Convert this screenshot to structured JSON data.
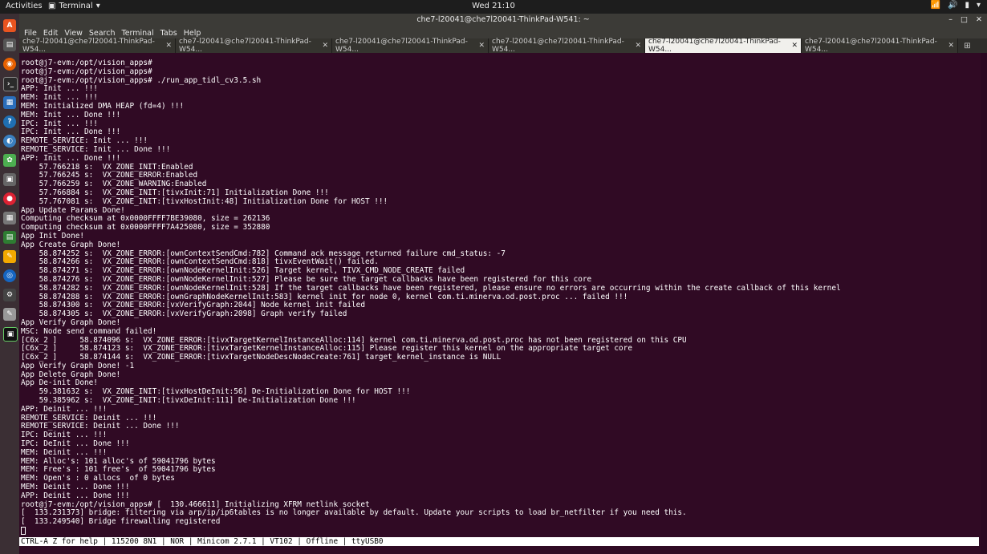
{
  "topbar": {
    "activities": "Activities",
    "app_name": "Terminal",
    "clock": "Wed 21:10"
  },
  "window": {
    "title": "che7-l20041@che7l20041-ThinkPad-W541: ~"
  },
  "menu": {
    "file": "File",
    "edit": "Edit",
    "view": "View",
    "search": "Search",
    "terminal": "Terminal",
    "tabs": "Tabs",
    "help": "Help"
  },
  "tabs": [
    {
      "label": "che7-l20041@che7l20041-ThinkPad-W54..."
    },
    {
      "label": "che7-l20041@che7l20041-ThinkPad-W54..."
    },
    {
      "label": "che7-l20041@che7l20041-ThinkPad-W54..."
    },
    {
      "label": "che7-l20041@che7l20041-ThinkPad-W54..."
    },
    {
      "label": "che7-l20041@che7l20041-ThinkPad-W54..."
    },
    {
      "label": "che7-l20041@che7l20041-ThinkPad-W54..."
    }
  ],
  "active_tab": 4,
  "terminal": {
    "lines": [
      "root@j7-evm:/opt/vision_apps#",
      "root@j7-evm:/opt/vision_apps#",
      "root@j7-evm:/opt/vision_apps# ./run_app_tidl_cv3.5.sh",
      "APP: Init ... !!!",
      "MEM: Init ... !!!",
      "MEM: Initialized DMA HEAP (fd=4) !!!",
      "MEM: Init ... Done !!!",
      "IPC: Init ... !!!",
      "IPC: Init ... Done !!!",
      "REMOTE_SERVICE: Init ... !!!",
      "REMOTE_SERVICE: Init ... Done !!!",
      "APP: Init ... Done !!!",
      "    57.766218 s:  VX_ZONE_INIT:Enabled",
      "    57.766245 s:  VX_ZONE_ERROR:Enabled",
      "    57.766259 s:  VX_ZONE_WARNING:Enabled",
      "    57.766884 s:  VX_ZONE_INIT:[tivxInit:71] Initialization Done !!!",
      "    57.767081 s:  VX_ZONE_INIT:[tivxHostInit:48] Initialization Done for HOST !!!",
      "App Update Params Done!",
      "Computing checksum at 0x0000FFFF7BE39080, size = 262136",
      "Computing checksum at 0x0000FFFF7A425080, size = 352880",
      "App Init Done!",
      "App Create Graph Done!",
      "    58.874252 s:  VX_ZONE_ERROR:[ownContextSendCmd:782] Command ack message returned failure cmd_status: -7",
      "    58.874266 s:  VX_ZONE_ERROR:[ownContextSendCmd:818] tivxEventWait() failed.",
      "    58.874271 s:  VX_ZONE_ERROR:[ownNodeKernelInit:526] Target kernel, TIVX_CMD_NODE_CREATE failed",
      "    58.874276 s:  VX_ZONE_ERROR:[ownNodeKernelInit:527] Please be sure the target callbacks have been registered for this core",
      "    58.874282 s:  VX_ZONE_ERROR:[ownNodeKernelInit:528] If the target callbacks have been registered, please ensure no errors are occurring within the create callback of this kernel",
      "    58.874288 s:  VX_ZONE_ERROR:[ownGraphNodeKernelInit:583] kernel init for node 0, kernel com.ti.minerva.od.post.proc ... failed !!!",
      "    58.874300 s:  VX_ZONE_ERROR:[vxVerifyGraph:2044] Node kernel init failed",
      "    58.874305 s:  VX_ZONE_ERROR:[vxVerifyGraph:2098] Graph verify failed",
      "App Verify Graph Done!",
      "MSC: Node send command failed!",
      "[C6x_2 ]     58.874096 s:  VX_ZONE_ERROR:[tivxTargetKernelInstanceAlloc:114] kernel com.ti.minerva.od.post.proc has not been registered on this CPU",
      "[C6x_2 ]     58.874123 s:  VX_ZONE_ERROR:[tivxTargetKernelInstanceAlloc:115] Please register this kernel on the appropriate target core",
      "[C6x_2 ]     58.874144 s:  VX_ZONE_ERROR:[tivxTargetNodeDescNodeCreate:761] target_kernel_instance is NULL",
      "App Verify Graph Done! -1",
      "App Delete Graph Done!",
      "App De-init Done!",
      "    59.381632 s:  VX_ZONE_INIT:[tivxHostDeInit:56] De-Initialization Done for HOST !!!",
      "    59.385962 s:  VX_ZONE_INIT:[tivxDeInit:111] De-Initialization Done !!!",
      "APP: Deinit ... !!!",
      "REMOTE_SERVICE: Deinit ... !!!",
      "REMOTE_SERVICE: Deinit ... Done !!!",
      "IPC: Deinit ... !!!",
      "IPC: DeInit ... Done !!!",
      "MEM: Deinit ... !!!",
      "MEM: Alloc's: 101 alloc's of 59041796 bytes",
      "MEM: Free's : 101 free's  of 59041796 bytes",
      "MEM: Open's : 0 allocs  of 0 bytes",
      "MEM: Deinit ... Done !!!",
      "APP: Deinit ... Done !!!",
      "root@j7-evm:/opt/vision_apps# [  130.466611] Initializing XFRM netlink socket",
      "[  133.231373] bridge: filtering via arp/ip/ip6tables is no longer available by default. Update your scripts to load br_netfilter if you need this.",
      "[  133.249540] Bridge firewalling registered"
    ]
  },
  "statusbar": {
    "text": "CTRL-A Z for help | 115200 8N1 | NOR | Minicom 2.7.1 | VT102 | Offline | ttyUSB0"
  }
}
